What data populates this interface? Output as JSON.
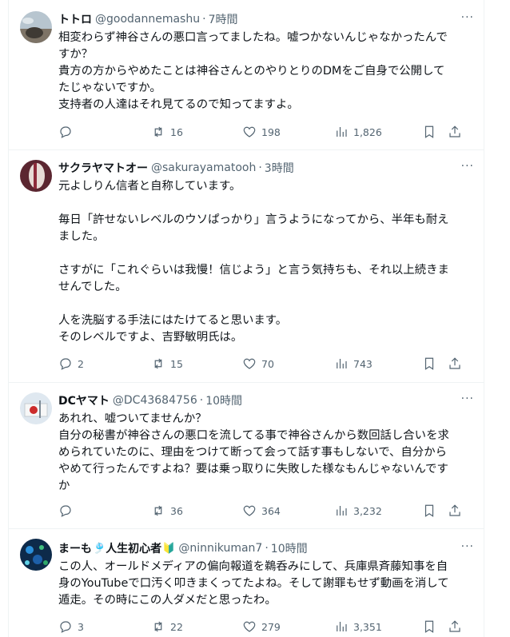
{
  "tweets": [
    {
      "name": "トトロ",
      "handle": "@goodannemashu",
      "dot": "·",
      "time": "7時間",
      "more": "···",
      "text": "相変わらず神谷さんの悪口言ってましたね。嘘つかないんじゃなかったんで\nすか？\n貴方の方からやめたことは神谷さんとのやりとりのDMをご自身で公開して\nたじゃないですか。\n支持者の人達はそれ見てるので知ってますよ。",
      "replies": "",
      "reposts": "16",
      "likes": "198",
      "views": "1,826"
    },
    {
      "name": "サクラヤマトオー",
      "handle": "@sakurayamatooh",
      "dot": "·",
      "time": "3時間",
      "more": "···",
      "text": "元よしりん信者と自称しています。\n\n毎日「許せないレベルのウソぱっかり」言うようになってから、半年も耐え\nました。\n\nさすがに「これぐらいは我慢！信じよう」と言う気持ちも、それ以上続きま\nせんでした。\n\n人を洗脳する手法にはたけてると思います。\nそのレベルですよ、吉野敏明氏は。",
      "replies": "2",
      "reposts": "15",
      "likes": "70",
      "views": "743"
    },
    {
      "name": "DCヤマト",
      "handle": "@DC43684756",
      "dot": "·",
      "time": "10時間",
      "more": "···",
      "text": "あれれ、嘘ついてませんか？\n自分の秘書が神谷さんの悪口を流してる事で神谷さんから数回話し合いを求\nめられていたのに、理由をつけて断って会って話す事もしないで、自分から\nやめて行ったんですよね？要は乗っ取りに失敗した様なもんじゃないんです\nか",
      "replies": "",
      "reposts": "36",
      "likes": "364",
      "views": "3,232"
    },
    {
      "name": "まーも",
      "name_emoji": "🎐",
      "name_suffix": "人生初心者",
      "name_badge": "🔰",
      "handle": "@ninnikuman7",
      "dot": "·",
      "time": "10時間",
      "more": "···",
      "text": "この人、オールドメディアの偏向報道を鵜呑みにして、兵庫県斉藤知事を自\n身のYouTubeで口汚く叩きまくってたよね。そして謝罪もせず動画を消して\n遁走。その時にこの人ダメだと思ったわ。",
      "replies": "3",
      "reposts": "22",
      "likes": "279",
      "views": "3,351"
    }
  ]
}
